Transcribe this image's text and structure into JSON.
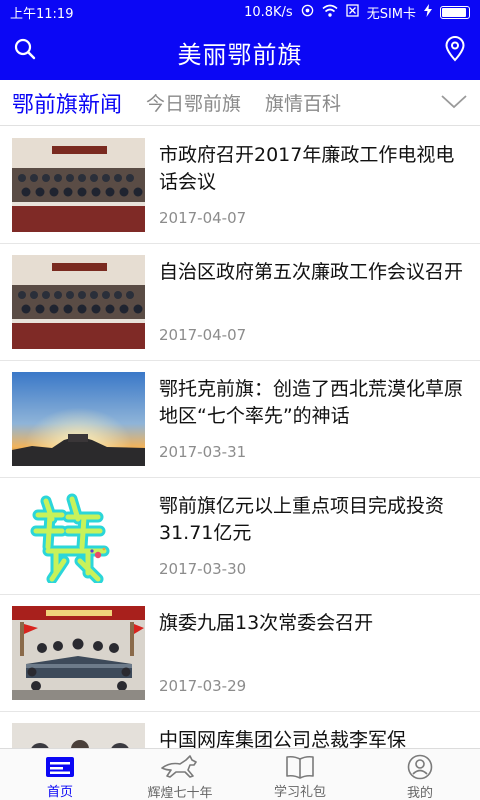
{
  "status_bar": {
    "time": "上午11:19",
    "network_speed": "10.8K/s",
    "sim_status": "无SIM卡"
  },
  "header": {
    "title": "美丽鄂前旗",
    "search_icon": "search-icon",
    "location_icon": "location-pin-icon"
  },
  "tabs": [
    {
      "label": "鄂前旗新闻",
      "active": true
    },
    {
      "label": "今日鄂前旗",
      "active": false
    },
    {
      "label": "旗情百科",
      "active": false
    }
  ],
  "news": [
    {
      "title": "市政府召开2017年廉政工作电视电话会议",
      "date": "2017-04-07"
    },
    {
      "title": "自治区政府第五次廉政工作会议召开",
      "date": "2017-04-07"
    },
    {
      "title": "鄂托克前旗：创造了西北荒漠化草原地区“七个率先”的神话",
      "date": "2017-03-31"
    },
    {
      "title": "鄂前旗亿元以上重点项目完成投资31.71亿元",
      "date": "2017-03-30"
    },
    {
      "title": "旗委九届13次常委会召开",
      "date": "2017-03-29"
    },
    {
      "title": "中国网库集团公司总裁李军保",
      "date": ""
    }
  ],
  "bottom_nav": [
    {
      "label": "首页",
      "icon": "home-icon",
      "active": true
    },
    {
      "label": "辉煌七十年",
      "icon": "horse-icon",
      "active": false
    },
    {
      "label": "学习礼包",
      "icon": "book-icon",
      "active": false
    },
    {
      "label": "我的",
      "icon": "user-icon",
      "active": false
    }
  ],
  "colors": {
    "brand_blue": "#0b07f5",
    "inactive_text": "#8a8a8a",
    "date_text": "#8c8c8c"
  }
}
